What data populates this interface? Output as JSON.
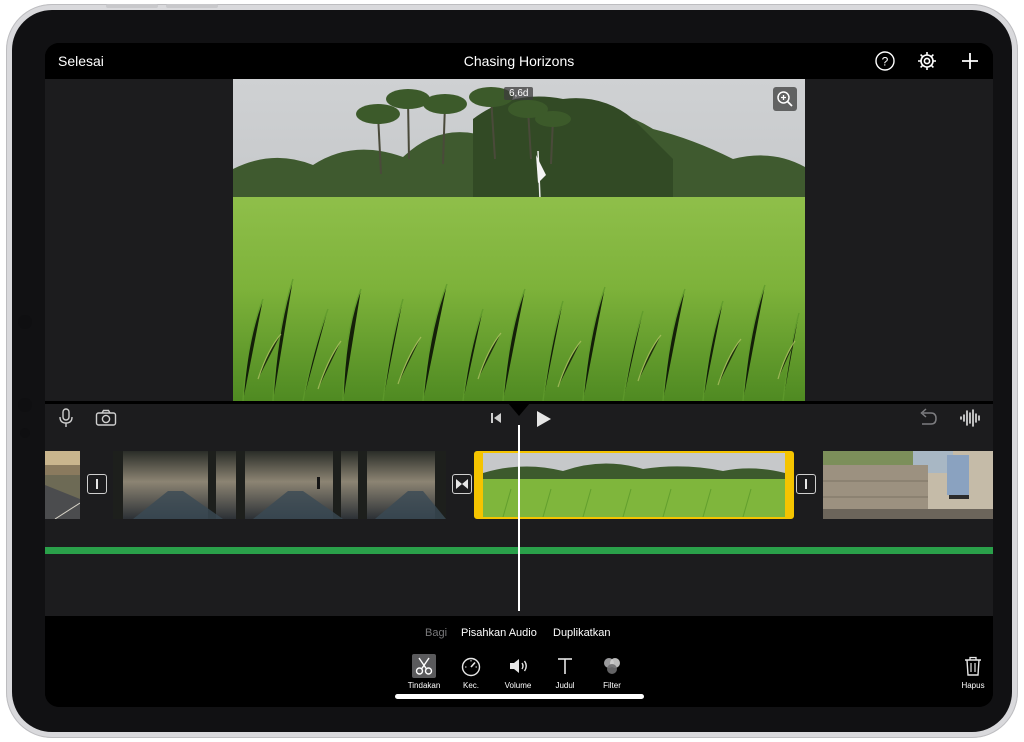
{
  "topbar": {
    "done_label": "Selesai",
    "project_title": "Chasing Horizons",
    "icons": [
      "help-icon",
      "settings-gear-icon",
      "add-plus-icon"
    ]
  },
  "viewer": {
    "clip_duration": "6,6d",
    "zoom_icon": "zoom-in-icon"
  },
  "timeline": {
    "left_controls": [
      "microphone-icon",
      "camera-icon"
    ],
    "center_controls": [
      "skip-to-start-icon",
      "play-icon"
    ],
    "right_controls": [
      "undo-icon",
      "audio-waveform-icon"
    ],
    "clips": [
      "road-sunset",
      "forest-road-cyclist",
      "rice-field-selected",
      "stone-wall-skater"
    ],
    "selected_clip_color": "#f5c400",
    "audio_track_color": "#2aa04a"
  },
  "panel": {
    "actions": {
      "split": "Bagi",
      "detach_audio": "Pisahkan Audio",
      "duplicate": "Duplikatkan"
    },
    "tools": {
      "actions": "Tindakan",
      "speed": "Kec.",
      "volume": "Volume",
      "titles": "Judul",
      "filter": "Filter"
    },
    "delete": "Hapus"
  }
}
